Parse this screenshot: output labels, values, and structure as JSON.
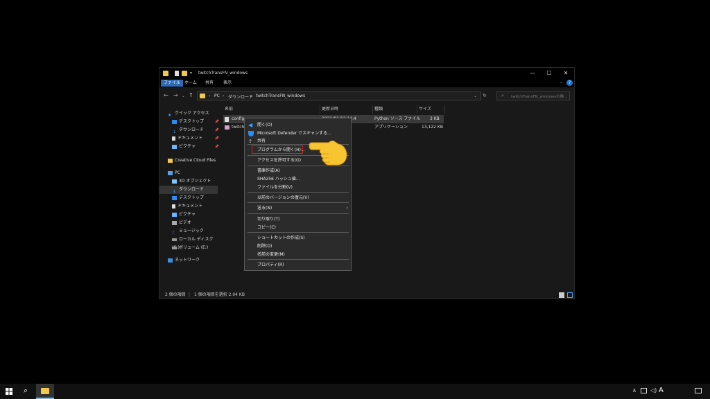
{
  "window": {
    "title": "twitchTransFN_windows",
    "ribbon_tabs": [
      "ファイル",
      "ホーム",
      "共有",
      "表示"
    ],
    "controls": {
      "minimize": "—",
      "maximize": "☐",
      "close": "✕"
    },
    "help": "?"
  },
  "navigation": {
    "breadcrumb": [
      "PC",
      "ダウンロード",
      "twitchTransFN_windows"
    ],
    "search_placeholder": "twitchTransFN_windowsの検..."
  },
  "sidebar": {
    "items": [
      {
        "label": "クイック アクセス",
        "icon": "star-icon"
      },
      {
        "label": "デスクトップ",
        "icon": "desktop-icon",
        "pinned": true
      },
      {
        "label": "ダウンロード",
        "icon": "download-icon",
        "pinned": true
      },
      {
        "label": "ドキュメント",
        "icon": "document-icon",
        "pinned": true
      },
      {
        "label": "ピクチャ",
        "icon": "picture-icon",
        "pinned": true
      },
      {
        "label": "Creative Cloud Files",
        "icon": "cloud-folder-icon"
      },
      {
        "label": "PC",
        "icon": "pc-icon"
      },
      {
        "label": "3D オブジェクト",
        "icon": "3d-icon"
      },
      {
        "label": "ダウンロード",
        "icon": "download-icon",
        "selected": true
      },
      {
        "label": "デスクトップ",
        "icon": "desktop-icon"
      },
      {
        "label": "ドキュメント",
        "icon": "document-icon"
      },
      {
        "label": "ピクチャ",
        "icon": "picture-icon"
      },
      {
        "label": "ビデオ",
        "icon": "video-icon"
      },
      {
        "label": "ミュージック",
        "icon": "music-icon"
      },
      {
        "label": "ローカル ディスク (C:)",
        "icon": "disk-icon"
      },
      {
        "label": "ボリューム (E:)",
        "icon": "disk-icon"
      },
      {
        "label": "ネットワーク",
        "icon": "network-icon"
      }
    ]
  },
  "file_list": {
    "columns": [
      "名前",
      "更新日時",
      "種類",
      "サイズ"
    ],
    "rows": [
      {
        "name": "config",
        "date": "2021/01/13 14:4",
        "type": "Python ソース ファイル",
        "size": "3 KB",
        "selected": true
      },
      {
        "name": "twitch",
        "date": "1",
        "type": "アプリケーション",
        "size": "13,122 KB",
        "selected": false
      }
    ]
  },
  "status": {
    "items_count": "2 個の項目",
    "selection": "1 個の項目を選択 2.04 KB"
  },
  "context_menu": {
    "items": [
      "開く(O)",
      "Microsoft Defender でスキャンする...",
      "共有",
      "プログラムから開く(H)...",
      "アクセスを許可する(G)",
      "書庫作成(A)",
      "SHA256 ハッシュ値...",
      "ファイルを分割(V)",
      "以前のバージョンの復元(V)",
      "送る(N)",
      "切り取り(T)",
      "コピー(C)",
      "ショートカットの作成(S)",
      "削除(D)",
      "名前の変更(M)",
      "プロパティ(R)"
    ],
    "highlighted_index": 3
  },
  "taskbar": {
    "ime_indicator": "A"
  },
  "colors": {
    "accent": "#2d6ab3",
    "highlight_box": "#e02020",
    "folder": "#f2c94c"
  }
}
